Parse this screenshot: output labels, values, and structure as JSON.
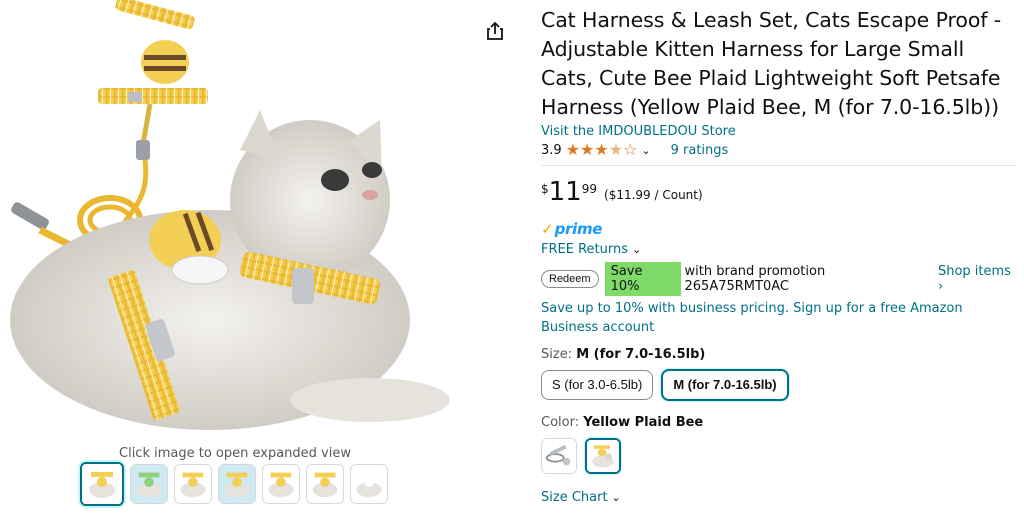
{
  "product": {
    "title": "Cat Harness & Leash Set, Cats Escape Proof - Adjustable Kitten Harness for Large Small Cats, Cute Bee Plaid Lightweight Soft Petsafe Harness (Yellow Plaid Bee, M (for 7.0-16.5lb))",
    "store_link": "Visit the IMDOUBLEDOU Store",
    "rating_value": "3.9",
    "rating_stars": 3.9,
    "ratings_count": "9 ratings"
  },
  "price": {
    "symbol": "$",
    "whole": "11",
    "fraction": "99",
    "unit_price": "($11.99 / Count)"
  },
  "prime": {
    "check": "✓",
    "label": "prime"
  },
  "returns": {
    "label": "FREE Returns"
  },
  "promo": {
    "redeem_label": "Redeem",
    "save_badge": "Save 10%",
    "text": "with brand promotion 265A75RMT0AC",
    "shop_items": "Shop items ›"
  },
  "business": {
    "text": "Save up to 10% with business pricing. Sign up for a free Amazon Business account"
  },
  "size": {
    "label": "Size:",
    "selected": "M (for 7.0-16.5lb)",
    "options": [
      "S (for 3.0-6.5lb)",
      "M (for 7.0-16.5lb)"
    ]
  },
  "color": {
    "label": "Color:",
    "selected": "Yellow Plaid Bee"
  },
  "size_chart": {
    "label": "Size Chart"
  },
  "gallery": {
    "hint": "Click image to open expanded view",
    "thumbnail_count": 7
  },
  "colors": {
    "link": "#007185",
    "star": "#de7921",
    "prime": "#1a98ff",
    "save_badge": "#7fda69",
    "harness_yellow": "#f2c94c"
  },
  "icons": {
    "share": "share-icon",
    "chevron": "chevron-down-icon",
    "star": "star-icon"
  }
}
